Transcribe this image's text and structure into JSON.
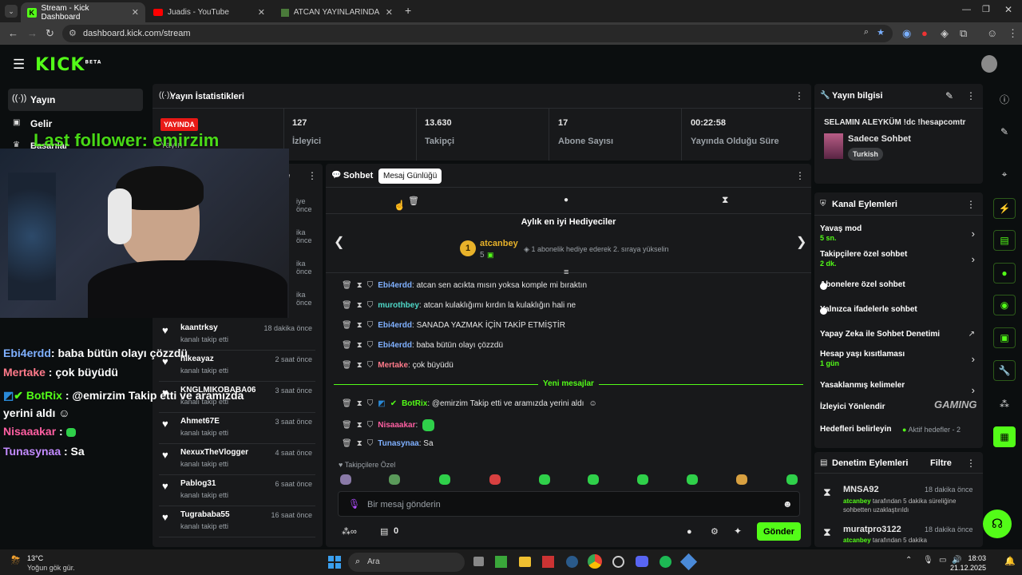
{
  "browser": {
    "tabs": [
      {
        "title": "Stream - Kick Dashboard",
        "active": true
      },
      {
        "title": "Juadis - YouTube",
        "active": false
      },
      {
        "title": "ATCAN YAYINLARINDA BU SEN...",
        "active": false
      }
    ],
    "url": "dashboard.kick.com/stream"
  },
  "nav": {
    "items": [
      {
        "label": "Yayın",
        "active": true
      },
      {
        "label": "Gelir",
        "active": false
      },
      {
        "label": "Başarılar",
        "active": false
      }
    ]
  },
  "overlay": {
    "last_follower": "Last follower: emirzim",
    "chat": [
      {
        "user": "Ebi4erdd",
        "text": ": baba bütün olayı çözzdü",
        "color": "#7fb0ff"
      },
      {
        "user": "Mertake",
        "text": " : çok büyüdü",
        "color": "#ff7a8a"
      },
      {
        "user": "BotRix",
        "text": " : @emirzim Takip etti ve aramızda yerini aldı",
        "color": "#53fc18"
      },
      {
        "user": "Nisaaakar",
        "text": " :",
        "color": "#ff5fa2"
      },
      {
        "user": "Tunasynaa",
        "text": " : Sa",
        "color": "#c38bff"
      }
    ]
  },
  "stats": {
    "title": "Yayın İstatistikleri",
    "live_badge": "YAYINDA",
    "live_sub": "Yayın",
    "items": [
      {
        "value": "127",
        "label": "İzleyici"
      },
      {
        "value": "13.630",
        "label": "Takipçi"
      },
      {
        "value": "17",
        "label": "Abone Sayısı"
      },
      {
        "value": "00:22:58",
        "label": "Yayında Olduğu Süre"
      }
    ]
  },
  "activity": {
    "header_tail": "e",
    "partial_times": [
      "iye önce",
      "ika önce",
      "ika önce",
      "ika önce"
    ],
    "followers": [
      {
        "name": "kaantrksy",
        "time": "18 dakika önce",
        "action": "kanalı takip etti"
      },
      {
        "name": "hikeayaz",
        "time": "2 saat önce",
        "action": "kanalı takip etti"
      },
      {
        "name": "KNGLMIKOBABA06",
        "time": "3 saat önce",
        "action": "kanalı takip etti"
      },
      {
        "name": "Ahmet67E",
        "time": "3 saat önce",
        "action": "kanalı takip etti"
      },
      {
        "name": "NexuxTheVlogger",
        "time": "4 saat önce",
        "action": "kanalı takip etti"
      },
      {
        "name": "Pablog31",
        "time": "6 saat önce",
        "action": "kanalı takip etti"
      },
      {
        "name": "Tugrababa55",
        "time": "16 saat önce",
        "action": "kanalı takip etti"
      }
    ]
  },
  "chat": {
    "title": "Sohbet",
    "tooltip": "Mesaj Günlüğü",
    "gifters_title": "Aylık en iyi Hediyeciler",
    "top_gifter": {
      "rank": "1",
      "name": "atcanbey",
      "count": "5"
    },
    "gift_hint": "1 abonelik hediye ederek 2. sıraya yükselin",
    "messages": [
      {
        "user": "Ebi4erdd",
        "text": ": atcan sen acıkta mısın yoksa komple mi bıraktın",
        "color": "#7fb0ff"
      },
      {
        "user": "murothbey",
        "text": ": atcan kulaklığımı kırdın la kulaklığın hali ne",
        "color": "#4fd8c8"
      },
      {
        "user": "Ebi4erdd",
        "text": ": SANADA YAZMAK İÇİN TAKİP ETMİŞTİR",
        "color": "#7fb0ff"
      },
      {
        "user": "Ebi4erdd",
        "text": ": baba bütün olayı çözzdü",
        "color": "#7fb0ff"
      },
      {
        "user": "Mertake",
        "text": ": çok büyüdü",
        "color": "#ff7a8a"
      }
    ],
    "new_messages_label": "Yeni mesajlar",
    "new_messages": [
      {
        "user": "BotRix",
        "text": ": @emirzim Takip etti ve aramızda yerini aldı",
        "color": "#53fc18"
      },
      {
        "user": "Nisaaakar",
        "text": ":",
        "color": "#ff5fa2"
      },
      {
        "user": "Tunasynaa",
        "text": ": Sa",
        "color": "#7fb0ff"
      }
    ],
    "emote_section": "Takipçilere Özel",
    "input_placeholder": "Bir mesaj gönderin",
    "points": "0",
    "send_label": "Gönder"
  },
  "stream_info": {
    "title": "Yayın bilgisi",
    "stream_title": "SELAMIN ALEYKÜM !dc !hesapcomtr",
    "category": "Sadece Sohbet",
    "language": "Turkish"
  },
  "channel_actions": {
    "title": "Kanal Eylemleri",
    "items": [
      {
        "label": "Yavaş mod",
        "sub": "5 sn."
      },
      {
        "label": "Takipçilere özel sohbet",
        "sub": "2 dk."
      },
      {
        "label": "Abonelere özel sohbet",
        "sub": ""
      },
      {
        "label": "Yalnızca ifadelerle sohbet",
        "sub": ""
      },
      {
        "label": "Yapay Zeka ile Sohbet Denetimi",
        "sub": ""
      },
      {
        "label": "Hesap yaşı kısıtlaması",
        "sub": "1 gün"
      },
      {
        "label": "Yasaklanmış kelimeler",
        "sub": ""
      },
      {
        "label": "İzleyici Yönlendir",
        "sub": ""
      },
      {
        "label": "Hedefleri belirleyin",
        "sub": "Aktif hedefler - 2"
      }
    ],
    "watermark": "GAMING"
  },
  "moderation": {
    "title": "Denetim Eylemleri",
    "filter": "Filtre",
    "items": [
      {
        "user": "MNSA92",
        "time": "18 dakika önce",
        "by": "atcanbey",
        "desc": "tarafından 5 dakika süreliğine sohbetten uzaklaştırıldı"
      },
      {
        "user": "muratpro3122",
        "time": "18 dakika önce",
        "by": "atcanbey",
        "desc": "tarafından 5 dakika"
      }
    ]
  },
  "taskbar": {
    "weather_temp": "13°C",
    "weather_desc": "Yoğun gök gür.",
    "search": "Ara",
    "time": "18:03",
    "date": "21.12.2025"
  },
  "colors": {
    "accent": "#53fc18",
    "live": "#e91916",
    "panel": "#18191b"
  }
}
